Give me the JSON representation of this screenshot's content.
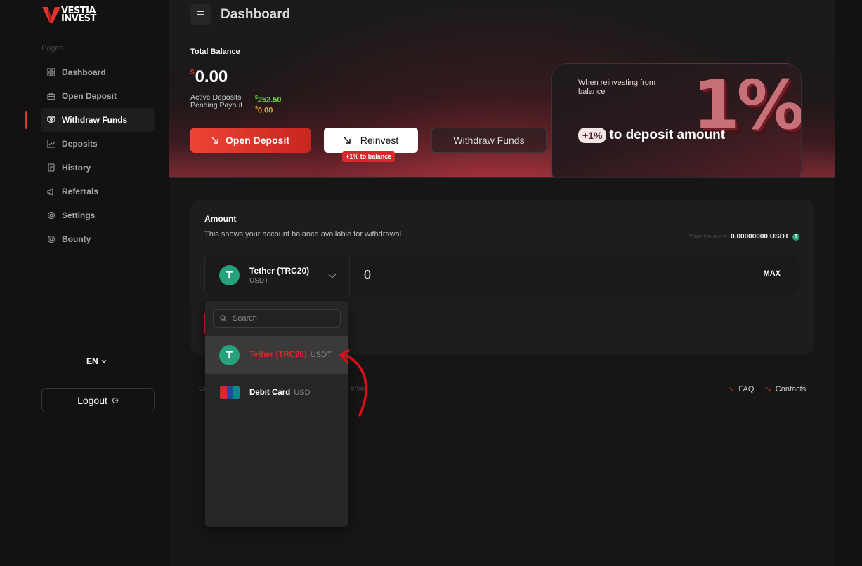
{
  "brand": {
    "line1": "VESTIA",
    "line2": "INVEST",
    "accent": "#e0322b"
  },
  "sidebar": {
    "section_label": "Pages",
    "items": [
      {
        "label": "Dashboard",
        "icon": "grid-icon"
      },
      {
        "label": "Open Deposit",
        "icon": "briefcase-icon"
      },
      {
        "label": "Withdraw Funds",
        "icon": "cash-icon",
        "active": true
      },
      {
        "label": "Deposits",
        "icon": "chart-icon"
      },
      {
        "label": "History",
        "icon": "document-icon"
      },
      {
        "label": "Referrals",
        "icon": "megaphone-icon"
      },
      {
        "label": "Settings",
        "icon": "gear-icon"
      },
      {
        "label": "Bounty",
        "icon": "target-icon"
      }
    ],
    "language": "EN",
    "logout_label": "Logout"
  },
  "header": {
    "title": "Dashboard"
  },
  "balance": {
    "label": "Total Balance",
    "currency_symbol": "$",
    "total": "0.00",
    "active_deposits_label": "Active Deposits",
    "pending_payout_label": "Pending Payout",
    "active_deposits_value": "252.50",
    "pending_payout_value": "0.00"
  },
  "actions": {
    "open_deposit": "Open Deposit",
    "reinvest": "Reinvest",
    "reinvest_badge": "+1% to balance",
    "withdraw": "Withdraw Funds"
  },
  "promo": {
    "text": "When reinvesting from balance",
    "pill": "+1%",
    "headline": "to deposit amount",
    "big_text": "1%"
  },
  "withdraw_form": {
    "title": "Amount",
    "subtitle": "This shows your account balance available for withdrawal",
    "your_balance_label": "Your balance",
    "your_balance_value": "0.00000000 USDT",
    "selected_coin_name": "Tether (TRC20)",
    "selected_coin_symbol": "USDT",
    "amount_value": "0",
    "max_label": "MAX"
  },
  "dropdown": {
    "search_placeholder": "Search",
    "options": [
      {
        "name": "Tether (TRC20)",
        "symbol": "USDT",
        "selected": true
      },
      {
        "name": "Debit Card",
        "symbol": "USD"
      }
    ]
  },
  "footer": {
    "copyright_start": "Co",
    "copyright_end": "erved",
    "links": [
      "FAQ",
      "Contacts"
    ]
  }
}
